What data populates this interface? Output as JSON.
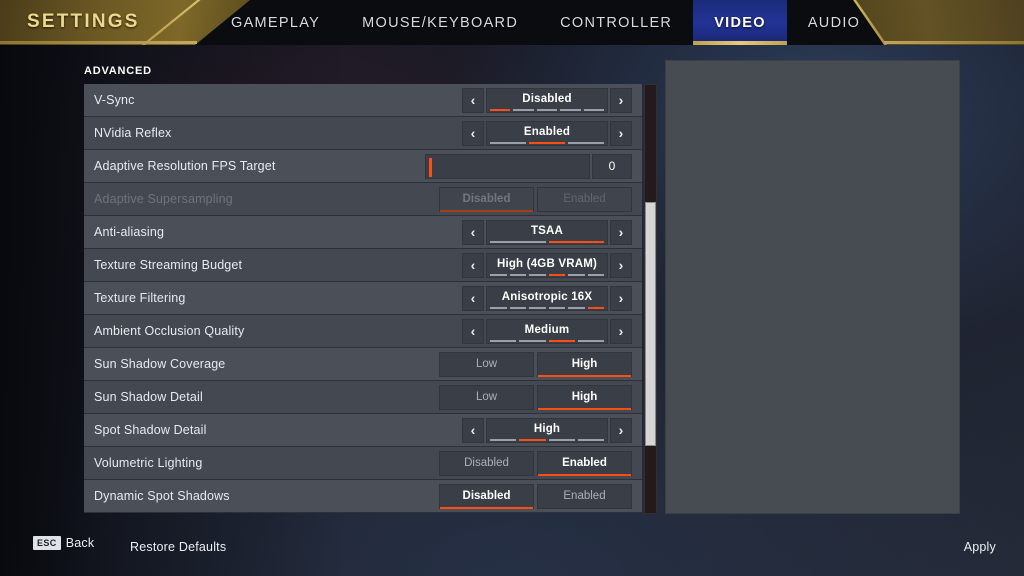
{
  "header": {
    "title": "SETTINGS",
    "tabs": [
      {
        "label": "GAMEPLAY",
        "active": false
      },
      {
        "label": "MOUSE/KEYBOARD",
        "active": false
      },
      {
        "label": "CONTROLLER",
        "active": false
      },
      {
        "label": "VIDEO",
        "active": true
      },
      {
        "label": "AUDIO",
        "active": false
      }
    ]
  },
  "section": {
    "label": "ADVANCED"
  },
  "colors": {
    "accent_orange": "#ff4d17",
    "tab_active_bg": "#223397",
    "tab_underline_gold": "#c0a14c",
    "gold_banner": "#7d6828",
    "row_bg": "#4a4f58",
    "control_bg": "#3a3f47"
  },
  "settings": [
    {
      "name": "V-Sync",
      "type": "spinner",
      "value": "Disabled",
      "segments": 5,
      "selected_index": 0,
      "disabled": false,
      "left_arrow": "‹",
      "right_arrow": "›"
    },
    {
      "name": "NVidia Reflex",
      "type": "spinner",
      "value": "Enabled",
      "segments": 3,
      "selected_index": 1,
      "disabled": false,
      "left_arrow": "‹",
      "right_arrow": "›"
    },
    {
      "name": "Adaptive Resolution FPS Target",
      "type": "slider",
      "value": "0",
      "slider_percent": 0,
      "disabled": false
    },
    {
      "name": "Adaptive Supersampling",
      "type": "toggle",
      "options": [
        "Disabled",
        "Enabled"
      ],
      "selected_index": 0,
      "disabled": true
    },
    {
      "name": "Anti-aliasing",
      "type": "spinner",
      "value": "TSAA",
      "segments": 2,
      "selected_index": 1,
      "disabled": false,
      "left_arrow": "‹",
      "right_arrow": "›"
    },
    {
      "name": "Texture Streaming Budget",
      "type": "spinner",
      "value": "High (4GB VRAM)",
      "segments": 6,
      "selected_index": 3,
      "disabled": false,
      "left_arrow": "‹",
      "right_arrow": "›"
    },
    {
      "name": "Texture Filtering",
      "type": "spinner",
      "value": "Anisotropic 16X",
      "segments": 6,
      "selected_index": 5,
      "disabled": false,
      "left_arrow": "‹",
      "right_arrow": "›"
    },
    {
      "name": "Ambient Occlusion Quality",
      "type": "spinner",
      "value": "Medium",
      "segments": 4,
      "selected_index": 2,
      "disabled": false,
      "left_arrow": "‹",
      "right_arrow": "›"
    },
    {
      "name": "Sun Shadow Coverage",
      "type": "toggle",
      "options": [
        "Low",
        "High"
      ],
      "selected_index": 1,
      "disabled": false
    },
    {
      "name": "Sun Shadow Detail",
      "type": "toggle",
      "options": [
        "Low",
        "High"
      ],
      "selected_index": 1,
      "disabled": false
    },
    {
      "name": "Spot Shadow Detail",
      "type": "spinner",
      "value": "High",
      "segments": 4,
      "selected_index": 1,
      "disabled": false,
      "left_arrow": "‹",
      "right_arrow": "›"
    },
    {
      "name": "Volumetric Lighting",
      "type": "toggle",
      "options": [
        "Disabled",
        "Enabled"
      ],
      "selected_index": 1,
      "disabled": false
    },
    {
      "name": "Dynamic Spot Shadows",
      "type": "toggle",
      "options": [
        "Disabled",
        "Enabled"
      ],
      "selected_index": 0,
      "disabled": false
    }
  ],
  "footer": {
    "esc_key": "ESC",
    "back_label": "Back",
    "restore_label": "Restore Defaults",
    "apply_label": "Apply"
  }
}
